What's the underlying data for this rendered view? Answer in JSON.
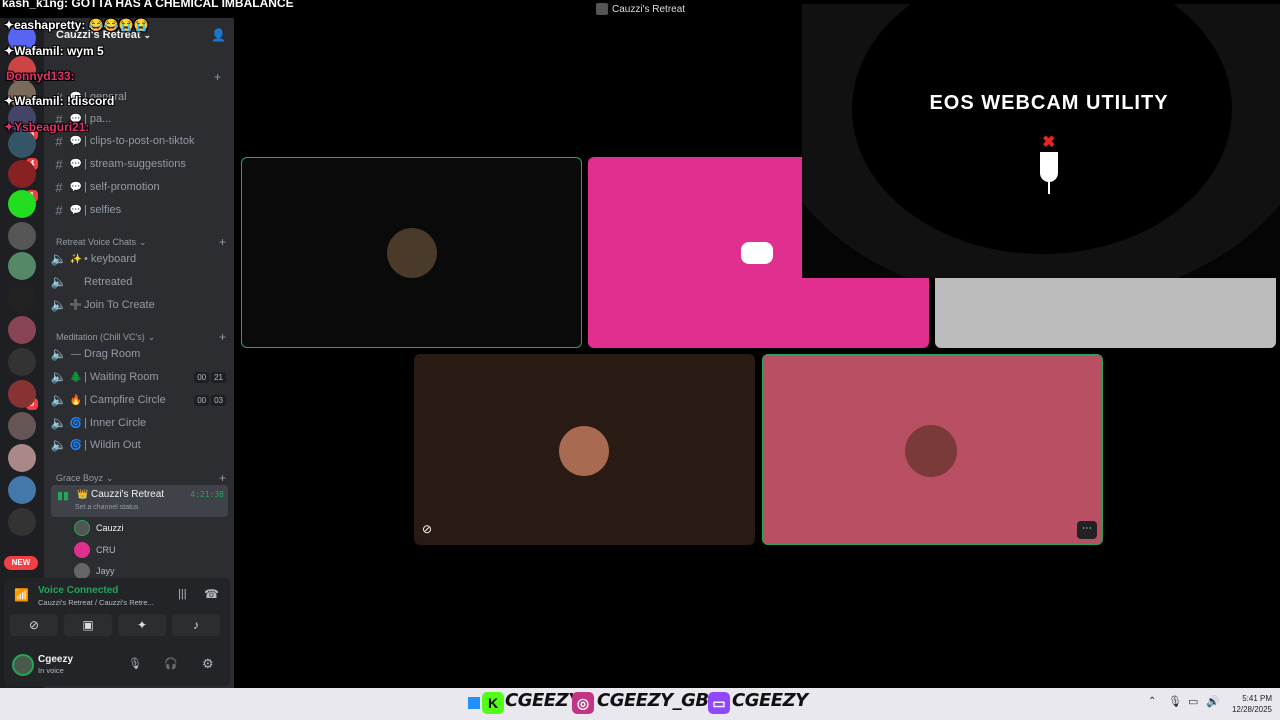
{
  "window": {
    "title": "Cauzzi's Retreat"
  },
  "overlay_chat": [
    {
      "user": "kash_k1ng:",
      "text": "GOTTA HAS A CHEMICAL IMBALANCE",
      "color": "#ffffff"
    },
    {
      "user": "eashapretty:",
      "text": "😂😂😭😭",
      "color": "#ffffff"
    },
    {
      "user": "Wafamil:",
      "text": "wym 5",
      "color": "#ffffff"
    },
    {
      "user": "Donnyd133:",
      "text": "",
      "color": "#e2306c"
    },
    {
      "user": "Wafamil:",
      "text": "!discord",
      "color": "#ffffff"
    },
    {
      "user": "Ysbeaguri21:",
      "text": "",
      "color": "#e2306c"
    }
  ],
  "server": {
    "name": "Cauzzi's Retreat"
  },
  "rail_badges": [
    "3",
    "4",
    "1",
    "5",
    "NEW"
  ],
  "channels": [
    {
      "name": "| general",
      "emoji": "💬"
    },
    {
      "name": "| pa...",
      "emoji": "💬"
    },
    {
      "name": "| clips-to-post-on-tiktok",
      "emoji": "💬"
    },
    {
      "name": "| stream-suggestions",
      "emoji": "💬"
    },
    {
      "name": "| self-promotion",
      "emoji": "💬"
    },
    {
      "name": "| selfies",
      "emoji": "💬"
    }
  ],
  "categories": {
    "retreat_voice": "Retreat Voice Chats",
    "meditation": "Meditation (Chill VC's)",
    "grace": "Grace Boyz"
  },
  "voice_channels_a": [
    {
      "name": "• keyboard",
      "emoji": "✨"
    },
    {
      "name": "Retreated",
      "emoji": ""
    },
    {
      "name": "Join To Create",
      "emoji": "➕"
    }
  ],
  "voice_channels_b": [
    {
      "name": "Drag Room",
      "emoji": "—",
      "t1": "",
      "t2": ""
    },
    {
      "name": "| Waiting Room",
      "emoji": "🌲",
      "t1": "00",
      "t2": "21"
    },
    {
      "name": "| Campfire Circle",
      "emoji": "🔥",
      "t1": "00",
      "t2": "03"
    },
    {
      "name": "| Inner Circle",
      "emoji": "🌀",
      "t1": "",
      "t2": ""
    },
    {
      "name": "| Wildin Out",
      "emoji": "🌀",
      "t1": "",
      "t2": ""
    }
  ],
  "active_voice": {
    "name": "Cauzzi's Retreat",
    "timer": "4:21:38",
    "status": "Set a channel status"
  },
  "members": [
    "Cauzzi",
    "CRU",
    "Jayy"
  ],
  "voice_panel": {
    "status": "Voice Connected",
    "location": "Cauzzi's Retreat / Cauzzi's Retre..."
  },
  "user": {
    "name": "Cgeezy",
    "status": "In voice"
  },
  "webcam_popup": {
    "title": "EOS WEBCAM UTILITY"
  },
  "taskbar": {
    "handles": [
      "CGEEZY",
      "CGEEZY_GBC",
      "CGEEZY"
    ],
    "time": "5:41 PM",
    "date": "12/28/2025"
  },
  "colors": {
    "accent": "#23a55a",
    "pink_tile": "#e12f8f",
    "rose_tile": "#b94f62",
    "brown_tile": "#2a1a14"
  }
}
